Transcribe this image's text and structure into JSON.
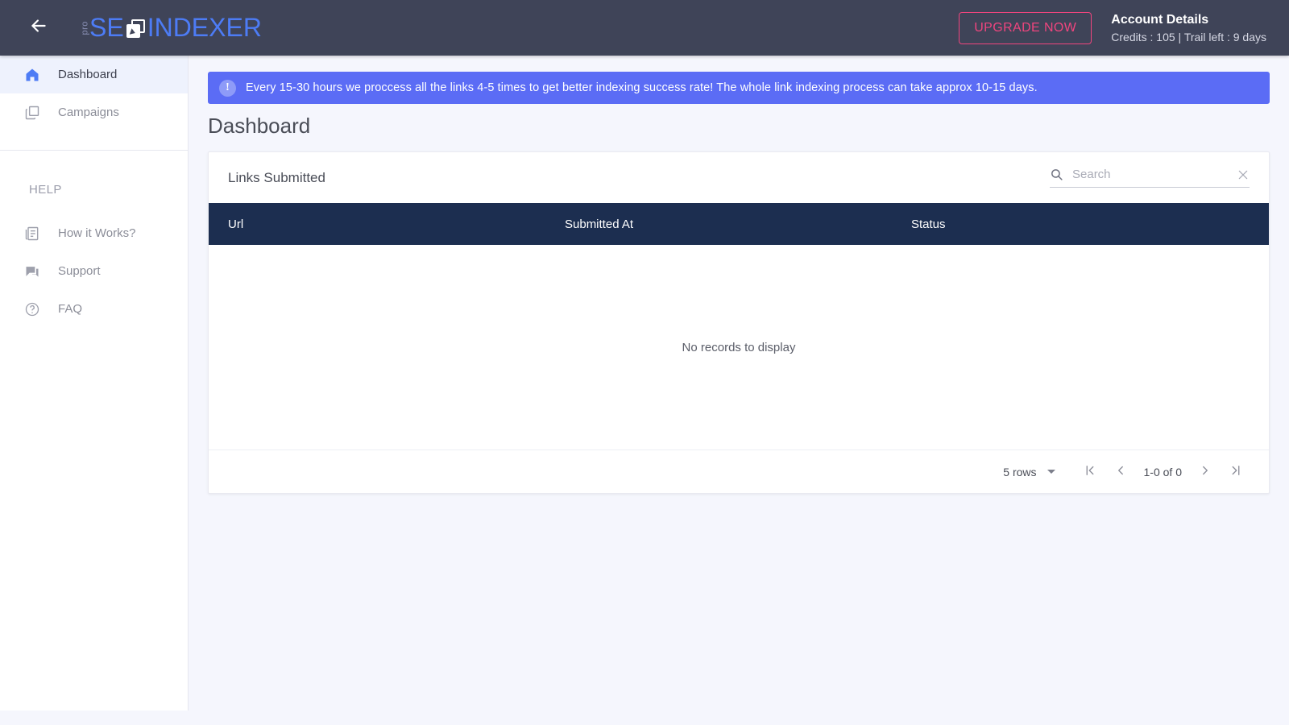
{
  "topbar": {
    "back_icon": "arrow-left-icon",
    "logo": {
      "pro": "pro",
      "se": "SE",
      "icon": "indexer-logo-icon",
      "indexer": "INDEXER"
    },
    "upgrade_label": "UPGRADE NOW",
    "account_title": "Account Details",
    "account_sub": "Credits : 105 | Trail left : 9 days",
    "colors": {
      "bar_bg": "#3f4458",
      "accent_pink": "#f0457e",
      "logo_blue": "#4d7cf5"
    }
  },
  "sidebar": {
    "items": [
      {
        "label": "Dashboard",
        "icon": "home-icon",
        "active": true
      },
      {
        "label": "Campaigns",
        "icon": "copy-icon",
        "active": false
      }
    ],
    "help_heading": "HELP",
    "help_items": [
      {
        "label": "How it Works?",
        "icon": "article-icon"
      },
      {
        "label": "Support",
        "icon": "chat-icon"
      },
      {
        "label": "FAQ",
        "icon": "help-circle-icon"
      }
    ]
  },
  "main": {
    "banner": {
      "icon": "info-icon",
      "text": "Every 15-30 hours we proccess all the links 4-5 times to get better indexing success rate! The whole link indexing process can take approx 10-15 days.",
      "bg": "#5b6cf5"
    },
    "page_title": "Dashboard",
    "card": {
      "title": "Links Submitted",
      "search": {
        "placeholder": "Search",
        "value": "",
        "icon": "search-icon",
        "clear_icon": "close-icon"
      },
      "table": {
        "columns": [
          "Url",
          "Submitted At",
          "Status"
        ],
        "rows": [],
        "empty_text": "No records to display",
        "header_bg": "#1c2e50"
      },
      "pagination": {
        "rows_per_page": "5 rows",
        "first_icon": "first-page-icon",
        "prev_icon": "chevron-left-icon",
        "range": "1-0 of 0",
        "next_icon": "chevron-right-icon",
        "last_icon": "last-page-icon"
      }
    }
  }
}
